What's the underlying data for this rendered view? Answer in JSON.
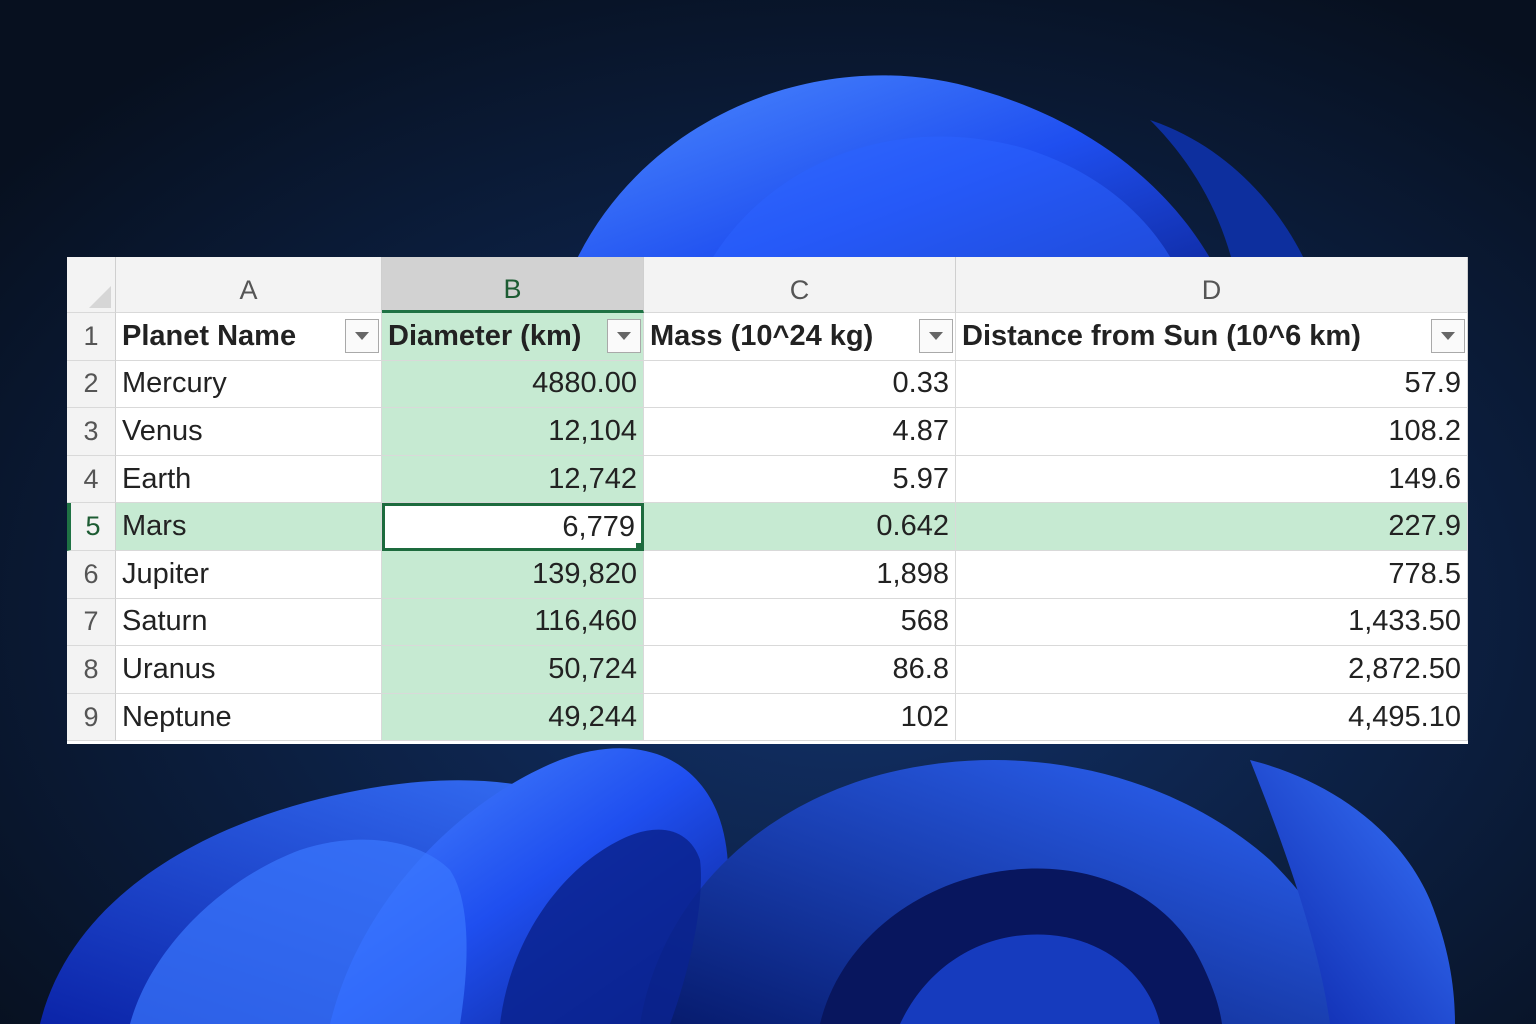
{
  "columns": [
    {
      "letter": "A",
      "header": "Planet Name"
    },
    {
      "letter": "B",
      "header": "Diameter (km)"
    },
    {
      "letter": "C",
      "header": "Mass (10^24 kg)"
    },
    {
      "letter": "D",
      "header": "Distance from Sun (10^6 km)"
    }
  ],
  "header_row_number": "1",
  "rows": [
    {
      "num": "2",
      "cells": [
        "Mercury",
        "4880.00",
        "0.33",
        "57.9"
      ]
    },
    {
      "num": "3",
      "cells": [
        "Venus",
        "12,104",
        "4.87",
        "108.2"
      ]
    },
    {
      "num": "4",
      "cells": [
        "Earth",
        "12,742",
        "5.97",
        "149.6"
      ]
    },
    {
      "num": "5",
      "cells": [
        "Mars",
        "6,779",
        "0.642",
        "227.9"
      ]
    },
    {
      "num": "6",
      "cells": [
        "Jupiter",
        "139,820",
        "1,898",
        "778.5"
      ]
    },
    {
      "num": "7",
      "cells": [
        "Saturn",
        "116,460",
        "568",
        "1,433.50"
      ]
    },
    {
      "num": "8",
      "cells": [
        "Uranus",
        "50,724",
        "86.8",
        "2,872.50"
      ]
    },
    {
      "num": "9",
      "cells": [
        "Neptune",
        "49,244",
        "102",
        "4,495.10"
      ]
    }
  ],
  "selection": {
    "column": "B",
    "row": "5",
    "active_cell": "B5"
  },
  "colors": {
    "selection_fill": "#c6ead2",
    "accent_green": "#1d6b3e",
    "header_gray": "#f3f3f3",
    "wallpaper_blue": "#1f4ff0",
    "wallpaper_background": "#0b1830"
  }
}
